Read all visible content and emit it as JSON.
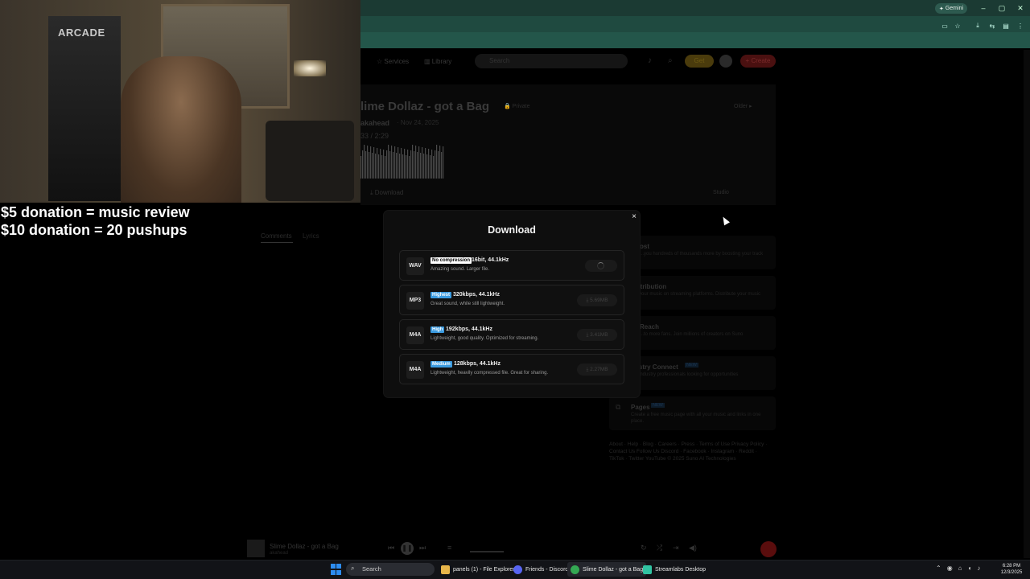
{
  "browser": {
    "gemini_label": "Gemini",
    "window_controls": [
      "–",
      "▢",
      "✕"
    ]
  },
  "webcam": {
    "arcade_sign": "ARCADE"
  },
  "overlay": {
    "line1": "$5 donation = music review",
    "line2": "$10 donation = 20 pushups"
  },
  "page": {
    "nav": {
      "services": "Services",
      "library": "Library"
    },
    "search_placeholder": "Search",
    "get_label": "Get",
    "create_label": "+ Create",
    "song_title": "lime Dollaz - got a Bag",
    "private_label": "Private",
    "artist": "akahead",
    "date": "· Nov 24, 2025",
    "time": "33 / 2:29",
    "download_label": "Download",
    "older_label": "Older",
    "studio_label": "Studio",
    "tabs": {
      "comments": "Comments",
      "lyrics": "Lyrics"
    },
    "side_cards": [
      {
        "title": "ost",
        "desc": "...you hundreds of thousands more by boosting your track"
      },
      {
        "title": "istribution",
        "desc": "...your music on streaming platforms. Distribute your music"
      },
      {
        "title": "Reach",
        "desc": "...to more fans. Join millions of creators on Suno"
      },
      {
        "title": "ustry Connect",
        "badge": "NEW",
        "desc": "...industry professionals looking for opportunities"
      },
      {
        "title": "Pages",
        "badge": "NEW",
        "desc": "Create a free music page with all your music and links in one place."
      }
    ],
    "footer": "About · Help · Blog · Careers · Press · Terms of Use Privacy Policy · Contact Us Follow Us Discord · Facebook · Instagram · Reddit · TikTok · Twitter YouTube © 2025 Suno AI Technologies"
  },
  "player": {
    "title": "Slime Dollaz - got a Bag",
    "artist": "akahead"
  },
  "modal": {
    "title": "Download",
    "close": "×",
    "options": [
      {
        "format": "WAV",
        "badge": "No compression",
        "badge_bg": "#ffffff",
        "badge_fg": "#000000",
        "spec": "16bit, 44.1kHz",
        "desc": "Amazing sound. Larger file.",
        "size": "",
        "loading": true
      },
      {
        "format": "MP3",
        "badge": "Highest",
        "badge_bg": "#3b9be0",
        "badge_fg": "#ffffff",
        "spec": "320kbps, 44.1kHz",
        "desc": "Great sound, while still lightweight.",
        "size": "⤓ 5.69MB",
        "loading": false
      },
      {
        "format": "M4A",
        "badge": "High",
        "badge_bg": "#3b9be0",
        "badge_fg": "#ffffff",
        "spec": "192kbps, 44.1kHz",
        "desc": "Lightweight, good quality. Optimized for streaming.",
        "size": "⤓ 3.41MB",
        "loading": false
      },
      {
        "format": "M4A",
        "badge": "Medium",
        "badge_bg": "#3b9be0",
        "badge_fg": "#ffffff",
        "spec": "128kbps, 44.1kHz",
        "desc": "Lightweight, heavily compressed file. Great for sharing.",
        "size": "⤓ 2.27MB",
        "loading": false
      }
    ]
  },
  "taskbar": {
    "search": "Search",
    "items": [
      {
        "label": "panels (1) - File Explorer",
        "color": "#e8b64a"
      },
      {
        "label": "Friends - Discord",
        "color": "#5865f2"
      },
      {
        "label": "Slime Dollaz - got a Bag",
        "color": "#34a853"
      },
      {
        "label": "Streamlabs Desktop",
        "color": "#31c3a2"
      }
    ],
    "time": "6:28 PM",
    "date": "12/3/2025"
  }
}
